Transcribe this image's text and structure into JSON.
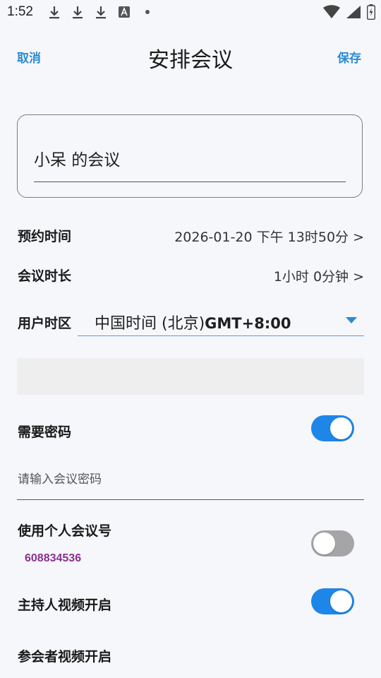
{
  "status_bar": {
    "time": "1:52",
    "notification_icons": [
      "download-icon",
      "download-icon",
      "download-icon",
      "font-app-icon",
      "dot-icon"
    ],
    "right_icons": [
      "wifi-icon",
      "signal-icon",
      "battery-icon"
    ]
  },
  "nav": {
    "cancel_label": "取消",
    "title": "安排会议",
    "save_label": "保存"
  },
  "topic": {
    "value": "小呆 的会议"
  },
  "schedule_time": {
    "label": "预约时间",
    "value": "2026-01-20 下午 13时50分 >"
  },
  "duration": {
    "label": "会议时长",
    "value": "1小时 0分钟 >"
  },
  "timezone": {
    "label": "用户时区",
    "name": "中国时间 (北京)",
    "gmt": "GMT+8:00"
  },
  "password": {
    "label": "需要密码",
    "enabled": true,
    "placeholder": "请输入会议密码"
  },
  "personal_meeting_id": {
    "label": "使用个人会议号",
    "enabled": false,
    "number": "608834536"
  },
  "host_video": {
    "label": "主持人视频开启",
    "enabled": true
  },
  "participant_video": {
    "label": "参会者视频开启"
  },
  "colors": {
    "accent": "#1e86e8",
    "link": "#2a8bd0",
    "pmi": "#8a2f8e"
  }
}
